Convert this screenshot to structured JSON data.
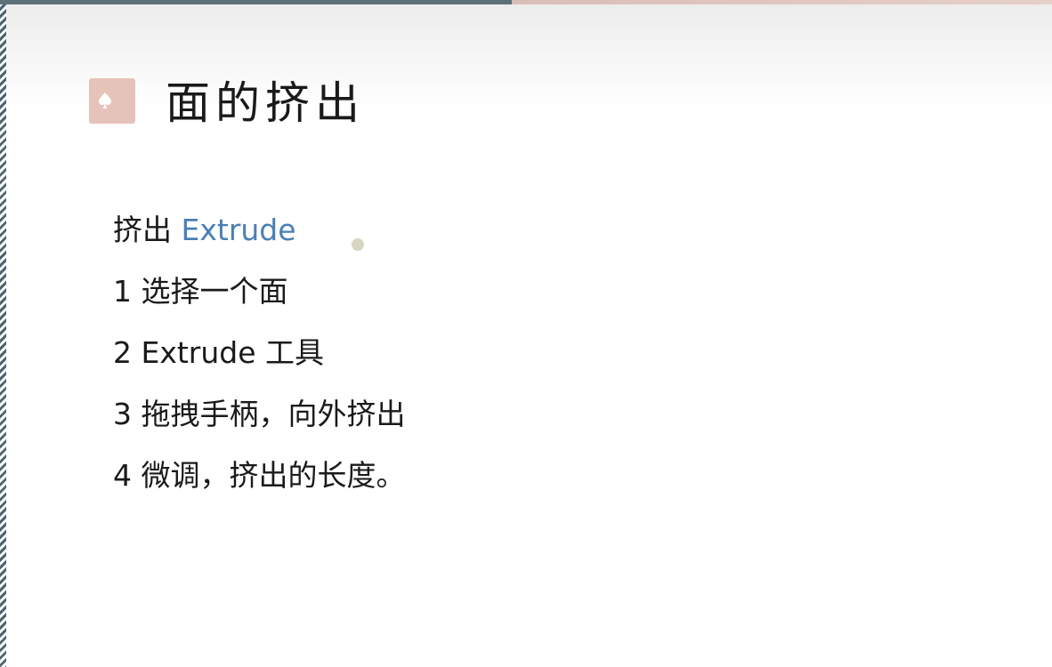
{
  "slide": {
    "title": "面的挤出",
    "subtitle_prefix": "挤出",
    "subtitle_term": "Extrude",
    "steps": [
      "1 选择一个面",
      "2 Extrude 工具",
      "3 拖拽手柄，向外挤出",
      "4 微调，挤出的长度。"
    ]
  },
  "icons": {
    "title_badge": "spade-icon"
  },
  "colors": {
    "accent_link": "#4a7fb5",
    "badge": "#e6c3b8",
    "top_bar_dark": "#5d6f78",
    "top_bar_light": "#e6cfc8",
    "left_stripe": "#4e6472",
    "cursor_dot": "#d8d6c0"
  }
}
